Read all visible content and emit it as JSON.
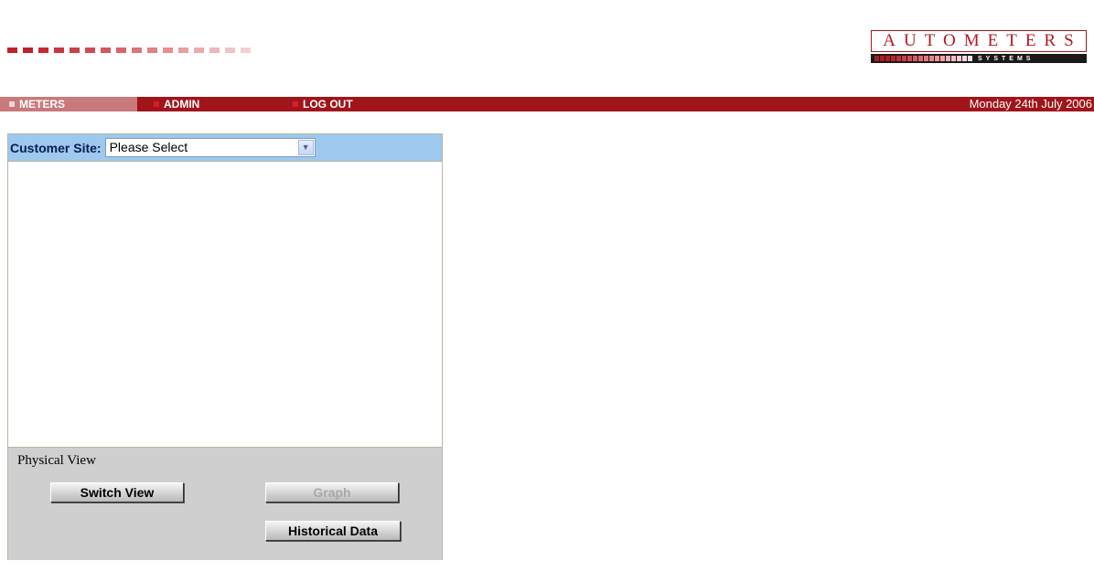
{
  "brand": {
    "logo_text": "AUTOMETERS",
    "logo_sub": "SYSTEMS",
    "accent_color": "#a0151a"
  },
  "nav": {
    "items": [
      {
        "label": "METERS",
        "active": true
      },
      {
        "label": "ADMIN",
        "active": false
      },
      {
        "label": "LOG OUT",
        "active": false
      }
    ],
    "date": "Monday 24th July 2006"
  },
  "panel": {
    "site_label": "Customer Site:",
    "site_select_value": "Please Select",
    "view_label": "Physical View",
    "buttons": {
      "switch_view": "Switch View",
      "graph": "Graph",
      "historical_data": "Historical Data"
    }
  },
  "icons": {
    "select_arrow": "chevron-down-icon",
    "nav_bullet": "square-bullet-icon"
  }
}
